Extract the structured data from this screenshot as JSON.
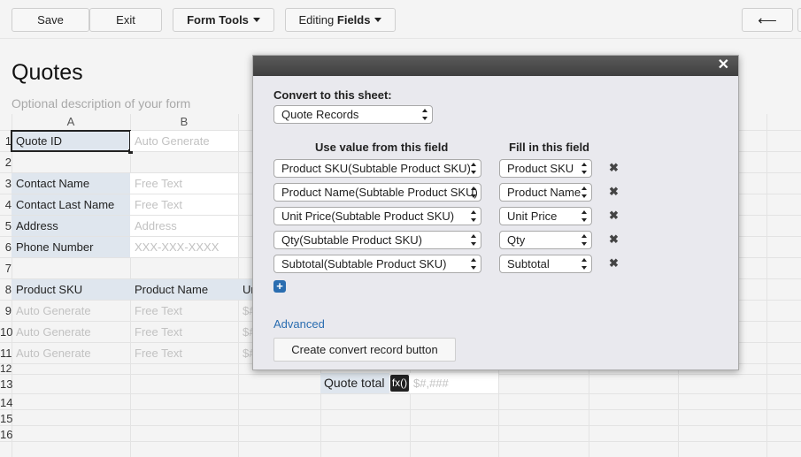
{
  "toolbar": {
    "save": "Save",
    "exit": "Exit",
    "form_tools": "Form Tools",
    "editing_prefix": "Editing ",
    "editing_bold": "Fields",
    "back_arrow": "⟵"
  },
  "form": {
    "title": "Quotes",
    "description": "Optional description of your form"
  },
  "grid": {
    "col_a": "A",
    "col_b": "B",
    "rows": [
      "1",
      "2",
      "3",
      "4",
      "5",
      "6",
      "7",
      "8",
      "9",
      "10",
      "11",
      "12",
      "13",
      "14",
      "15",
      "16"
    ],
    "r1": {
      "label": "Quote ID",
      "value": "Auto Generate"
    },
    "r3": {
      "label": "Contact Name",
      "value": "Free Text"
    },
    "r4": {
      "label": "Contact Last Name",
      "value": "Free Text"
    },
    "r5": {
      "label": "Address",
      "value": "Address"
    },
    "r6": {
      "label": "Phone Number",
      "value": "XXX-XXX-XXXX"
    },
    "sub_headers": [
      "Product SKU",
      "Product Name",
      "Ur"
    ],
    "sub_rows": [
      [
        "Auto Generate",
        "Free Text",
        "$#"
      ],
      [
        "Auto Generate",
        "Free Text",
        "$#"
      ],
      [
        "Auto Generate",
        "Free Text",
        "$#"
      ]
    ],
    "quote_total_label": "Quote total",
    "fx": "fx()",
    "quote_total_value": "$#,###"
  },
  "modal": {
    "close": "✕",
    "convert_label": "Convert to this sheet:",
    "convert_sheet": "Quote Records",
    "use_value_header": "Use value from this field",
    "fill_in_header": "Fill in this field",
    "mappings": [
      {
        "from": "Product SKU(Subtable Product SKU)",
        "to": "Product SKU"
      },
      {
        "from": "Product Name(Subtable Product SKU)",
        "to": "Product Name"
      },
      {
        "from": "Unit Price(Subtable Product SKU)",
        "to": "Unit Price"
      },
      {
        "from": "Qty(Subtable Product SKU)",
        "to": "Qty"
      },
      {
        "from": "Subtotal(Subtable Product SKU)",
        "to": "Subtotal"
      }
    ],
    "delete_icon": "✖",
    "add_icon": "+",
    "advanced": "Advanced",
    "create_button": "Create convert record button"
  }
}
